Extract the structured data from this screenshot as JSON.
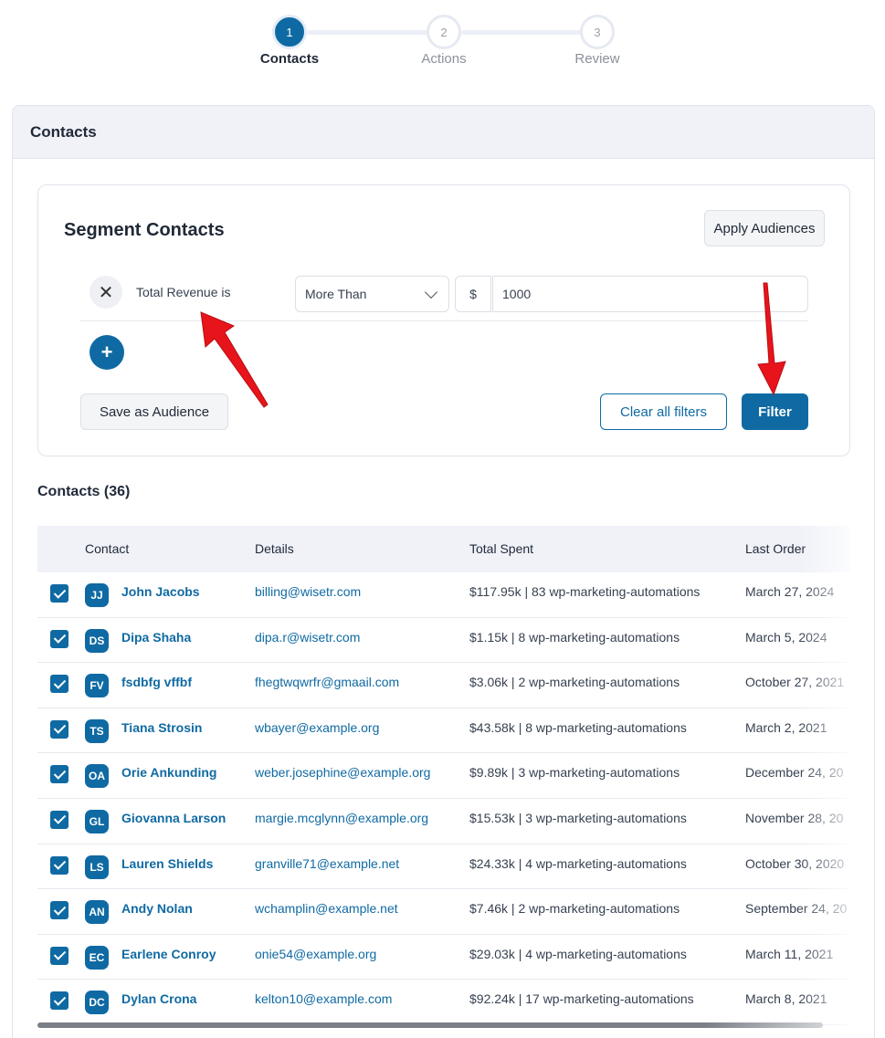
{
  "stepper": {
    "steps": [
      {
        "num": "1",
        "label": "Contacts"
      },
      {
        "num": "2",
        "label": "Actions"
      },
      {
        "num": "3",
        "label": "Review"
      }
    ]
  },
  "panel": {
    "title": "Contacts"
  },
  "segment": {
    "title": "Segment Contacts",
    "apply_label": "Apply Audiences",
    "filter": {
      "label": "Total Revenue is",
      "operator": "More Than",
      "currency": "$",
      "value": "1000"
    },
    "save_label": "Save as Audience",
    "clear_label": "Clear all filters",
    "filter_label": "Filter"
  },
  "contacts": {
    "title": "Contacts (36)",
    "columns": [
      "Contact",
      "Details",
      "Total Spent",
      "Last Order"
    ],
    "rows": [
      {
        "initials": "JJ",
        "name": "John Jacobs",
        "email": "billing@wisetr.com",
        "spent": "$117.95k | 83 wp-marketing-automations",
        "last_order": "March 27, 2024"
      },
      {
        "initials": "DS",
        "name": "Dipa Shaha",
        "email": "dipa.r@wisetr.com",
        "spent": "$1.15k | 8 wp-marketing-automations",
        "last_order": "March 5, 2024"
      },
      {
        "initials": "FV",
        "name": "fsdbfg vffbf",
        "email": "fhegtwqwrfr@gmaail.com",
        "spent": "$3.06k | 2 wp-marketing-automations",
        "last_order": "October 27, 2021"
      },
      {
        "initials": "TS",
        "name": "Tiana Strosin",
        "email": "wbayer@example.org",
        "spent": "$43.58k | 8 wp-marketing-automations",
        "last_order": "March 2, 2021"
      },
      {
        "initials": "OA",
        "name": "Orie Ankunding",
        "email": "weber.josephine@example.org",
        "spent": "$9.89k | 3 wp-marketing-automations",
        "last_order": "December 24, 20"
      },
      {
        "initials": "GL",
        "name": "Giovanna Larson",
        "email": "margie.mcglynn@example.org",
        "spent": "$15.53k | 3 wp-marketing-automations",
        "last_order": "November 28, 20"
      },
      {
        "initials": "LS",
        "name": "Lauren Shields",
        "email": "granville71@example.net",
        "spent": "$24.33k | 4 wp-marketing-automations",
        "last_order": "October 30, 2020"
      },
      {
        "initials": "AN",
        "name": "Andy Nolan",
        "email": "wchamplin@example.net",
        "spent": "$7.46k | 2 wp-marketing-automations",
        "last_order": "September 24, 20"
      },
      {
        "initials": "EC",
        "name": "Earlene Conroy",
        "email": "onie54@example.org",
        "spent": "$29.03k | 4 wp-marketing-automations",
        "last_order": "March 11, 2021"
      },
      {
        "initials": "DC",
        "name": "Dylan Crona",
        "email": "kelton10@example.com",
        "spent": "$92.24k | 17 wp-marketing-automations",
        "last_order": "March 8, 2021"
      }
    ]
  },
  "colors": {
    "primary": "#0f6aa3",
    "arrow": "#e8141b"
  }
}
